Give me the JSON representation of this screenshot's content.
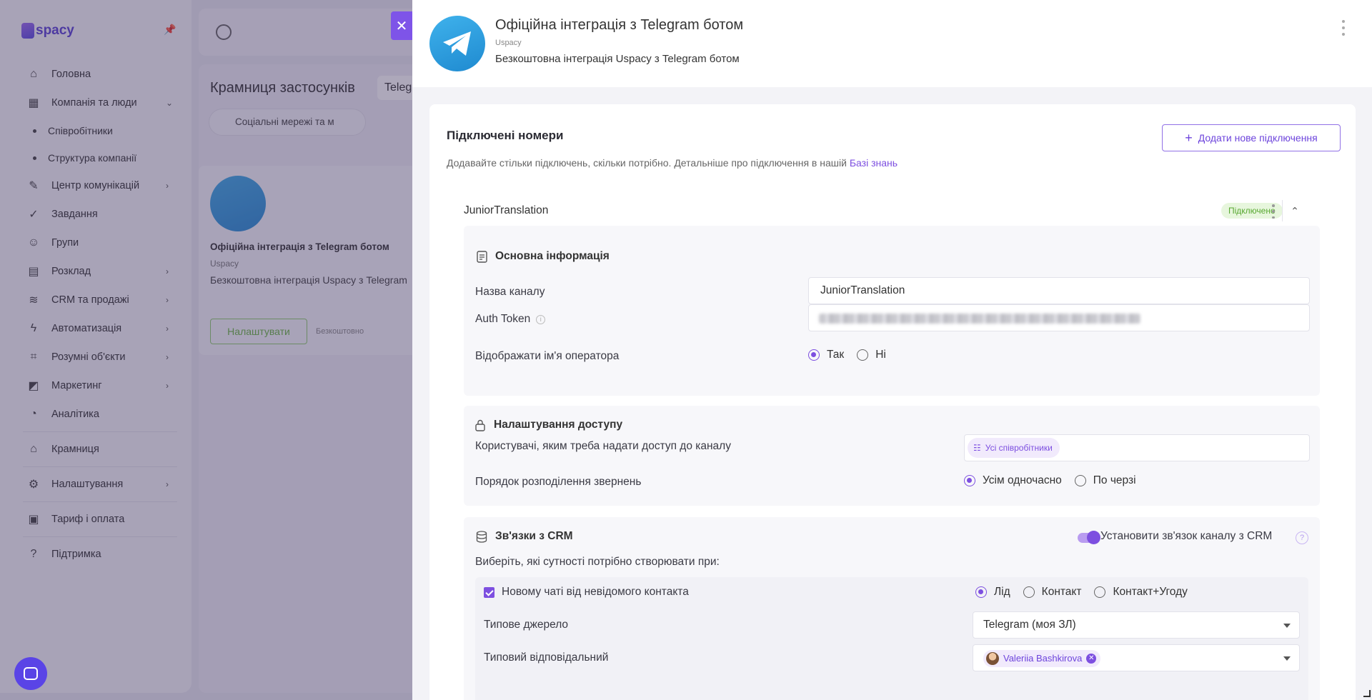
{
  "sidebar": {
    "logo_text": "spacy",
    "items": [
      {
        "label": "Головна",
        "icon": "home-icon"
      },
      {
        "label": "Компанія та люди",
        "icon": "building-icon"
      },
      {
        "label": "Співробітники"
      },
      {
        "label": "Структура компанії"
      },
      {
        "label": "Центр комунікацій",
        "icon": "chat-edit-icon"
      },
      {
        "label": "Завдання",
        "icon": "check-circle-icon"
      },
      {
        "label": "Групи",
        "icon": "user-icon"
      },
      {
        "label": "Розклад",
        "icon": "calendar-icon"
      },
      {
        "label": "CRM та продажі",
        "icon": "database-icon"
      },
      {
        "label": "Автоматизація",
        "icon": "bolt-icon"
      },
      {
        "label": "Розумні об'єкти",
        "icon": "scan-icon"
      },
      {
        "label": "Маркетинг",
        "icon": "megaphone-icon"
      },
      {
        "label": "Аналітика",
        "icon": "chart-icon"
      },
      {
        "label": "Крамниця",
        "icon": "store-icon"
      },
      {
        "label": "Налаштування",
        "icon": "gear-icon"
      },
      {
        "label": "Тариф і оплата",
        "icon": "wallet-icon"
      },
      {
        "label": "Підтримка",
        "icon": "help-icon"
      }
    ]
  },
  "store": {
    "title": "Крамниця застосунків",
    "tab": "Teleg",
    "filter": "Соціальні мережі та м",
    "card": {
      "title": "Офіційна інтеграція з Telegram ботом",
      "vendor": "Uspacy",
      "desc": "Безкоштовна інтеграція Uspacy з Telegram",
      "button": "Налаштувати",
      "price": "Безкоштовно"
    }
  },
  "drawer": {
    "title": "Офіційна інтеграція з Telegram ботом",
    "vendor": "Uspacy",
    "desc": "Безкоштовна інтеграція Uspacy з Telegram ботом",
    "close": "✕",
    "section_title": "Підключені номери",
    "add_button": "Додати нове підключення",
    "note": "Додавайте стільки підключень, скільки потрібно. Детальніше про підключення в нашій ",
    "note_link": "Базі знань",
    "connection": {
      "name": "JuniorTranslation",
      "status": "Підключено"
    },
    "basic": {
      "title": "Основна інформація",
      "channel_label": "Назва каналу",
      "channel_value": "JuniorTranslation",
      "token_label": "Auth Token",
      "show_operator_label": "Відображати ім'я оператора",
      "yes": "Так",
      "no": "Ні",
      "selected": "Так"
    },
    "access": {
      "title": "Налаштування доступу",
      "users_label": "Користувачі, яким треба надати доступ до каналу",
      "users_chip": "Усі співробітники",
      "order_label": "Порядок розподілення звернень",
      "opt_all": "Усім одночасно",
      "opt_queue": "По черзі",
      "selected": "Усім одночасно"
    },
    "crm": {
      "title": "Зв'язки з CRM",
      "toggle_label": "Установити зв'язок каналу з CRM",
      "toggle_on": true,
      "prompt": "Виберіть, які сутності потрібно створювати при:",
      "new_chat_label": "Новому чаті від невідомого контакта",
      "opt_lead": "Лід",
      "opt_contact": "Контакт",
      "opt_deal": "Контакт+Угоду",
      "selected": "Лід",
      "source_label": "Типове джерело",
      "source_value": "Telegram (моя ЗЛ)",
      "owner_label": "Типовий відповідальний",
      "owner_value": "Valeriia Bashkirova"
    }
  },
  "colors": {
    "accent": "#7d4fe0",
    "status_green": "#58a831",
    "telegram_blue": "#2a9ee0"
  }
}
